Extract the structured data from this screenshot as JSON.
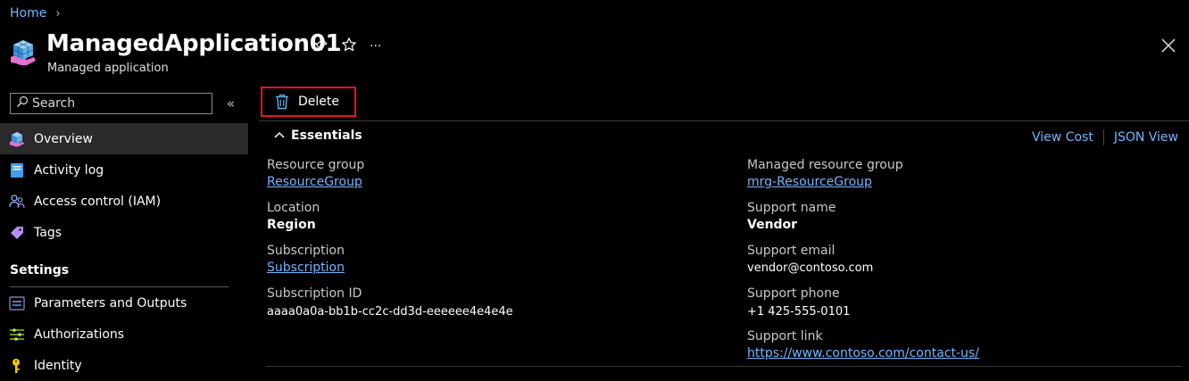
{
  "breadcrumb": {
    "home": "Home",
    "separator": "›"
  },
  "header": {
    "title": "ManagedApplication01",
    "subtitle": "Managed application",
    "icon": "managed-application-icon",
    "actions": {
      "more": "···"
    }
  },
  "sidebar": {
    "search_placeholder": "Search",
    "collapse": "«",
    "items": [
      {
        "label": "Overview",
        "icon": "overview-cube-icon"
      },
      {
        "label": "Activity log",
        "icon": "activity-log-icon"
      },
      {
        "label": "Access control (IAM)",
        "icon": "people-icon"
      },
      {
        "label": "Tags",
        "icon": "tag-icon"
      }
    ],
    "section": "Settings",
    "settings_items": [
      {
        "label": "Parameters and Outputs",
        "icon": "parameters-icon"
      },
      {
        "label": "Authorizations",
        "icon": "authorizations-icon"
      },
      {
        "label": "Identity",
        "icon": "identity-key-icon"
      }
    ]
  },
  "toolbar": {
    "delete_label": "Delete"
  },
  "essentials": {
    "title": "Essentials",
    "view_cost": "View Cost",
    "json_view": "JSON View",
    "left": [
      {
        "label": "Resource group",
        "value": "ResourceGroup"
      },
      {
        "label": "Location",
        "value": "Region"
      },
      {
        "label": "Subscription",
        "value": "Subscription"
      },
      {
        "label": "Subscription ID",
        "value": "aaaa0a0a-bb1b-cc2c-dd3d-eeeeee4e4e4e"
      }
    ],
    "right": [
      {
        "label": "Managed resource group",
        "value": "mrg-ResourceGroup"
      },
      {
        "label": "Support name",
        "value": "Vendor"
      },
      {
        "label": "Support email",
        "value": "vendor@contoso.com"
      },
      {
        "label": "Support phone",
        "value": "+1 425-555-0101"
      },
      {
        "label": "Support link",
        "value": "https://www.contoso.com/contact-us/"
      }
    ]
  },
  "colors": {
    "accent_link": "#75b6ff",
    "highlight_border": "#e81123",
    "background": "#000000"
  }
}
